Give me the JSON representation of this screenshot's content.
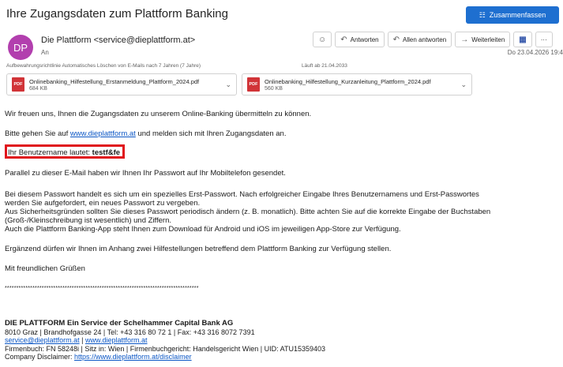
{
  "email": {
    "subject": "Ihre Zugangsdaten zum Plattform Banking",
    "summarize_label": "Zusammenfassen",
    "avatar_initials": "DP",
    "sender": "Die Plattform <service@dieplattform.at>",
    "to_label": "An",
    "date": "Do 23.04.2026 19:4",
    "retention": "Aufbewahrungsrichtlinie   Automatisches Löschen von E-Mails nach 7 Jahren (7 Jahre)",
    "expires": "Läuft ab   21.04.2033"
  },
  "actions": {
    "reply": "Antworten",
    "reply_all": "Allen antworten",
    "forward": "Weiterleiten",
    "more": "···"
  },
  "attachments": [
    {
      "name": "Onlinebanking_Hilfestellung_Erstanmeldung_Plattform_2024.pdf",
      "size": "684 KB",
      "type": "PDF"
    },
    {
      "name": "Onlinebanking_Hilfestellung_Kurzanleitung_Plattform_2024.pdf",
      "size": "560 KB",
      "type": "PDF"
    }
  ],
  "body": {
    "p1": "Wir freuen uns, Ihnen die Zugangsdaten zu unserem Online-Banking übermitteln zu können.",
    "p2_pre": "Bitte gehen Sie auf ",
    "p2_link": "www.dieplattform.at",
    "p2_post": " und melden sich mit Ihren Zugangsdaten an.",
    "user_label": "Ihr Benutzername lautet: ",
    "username": "testf&fe",
    "p4": "Parallel zu dieser E-Mail haben wir Ihnen Ihr Passwort auf Ihr Mobiltelefon gesendet.",
    "p5_l1": "Bei diesem Passwort handelt es sich um ein spezielles Erst-Passwort. Nach erfolgreicher Eingabe Ihres Benutzernamens und Erst-Passwortes",
    "p5_l2": "werden Sie aufgefordert, ein neues Passwort zu vergeben.",
    "p5_l3": "Aus Sicherheitsgründen sollten Sie dieses Passwort periodisch ändern (z. B. monatlich). Bitte achten Sie auf die korrekte Eingabe der Buchstaben",
    "p5_l4": "(Groß-/Kleinschreibung ist wesentlich) und Ziffern.",
    "p5_l5": "Auch die Plattform Banking-App steht Ihnen zum Download für Android und iOS im jeweiligen App-Store zur Verfügung.",
    "p6": "Ergänzend dürfen wir Ihnen im Anhang zwei Hilfestellungen betreffend dem Plattform Banking zur Verfügung stellen.",
    "greeting": "Mit freundlichen Grüßen",
    "separator": "************************************************************************************"
  },
  "signature": {
    "company": "DIE PLATTFORM Ein Service der Schelhammer Capital Bank AG",
    "address": "8010 Graz | Brandhofgasse 24 | Tel: +43 316 80 72 1 | Fax: +43 316 8072 7391",
    "email_link": "service@dieplattform.at",
    "sep": " | ",
    "web_link": "www.dieplattform.at",
    "register": "Firmenbuch: FN 58248i | Sitz in: Wien | Firmenbuchgericht: Handelsgericht Wien | UID: ATU15359403",
    "disclaimer_label": "Company Disclaimer: ",
    "disclaimer_link": "https://www.dieplattform.at/disclaimer"
  }
}
